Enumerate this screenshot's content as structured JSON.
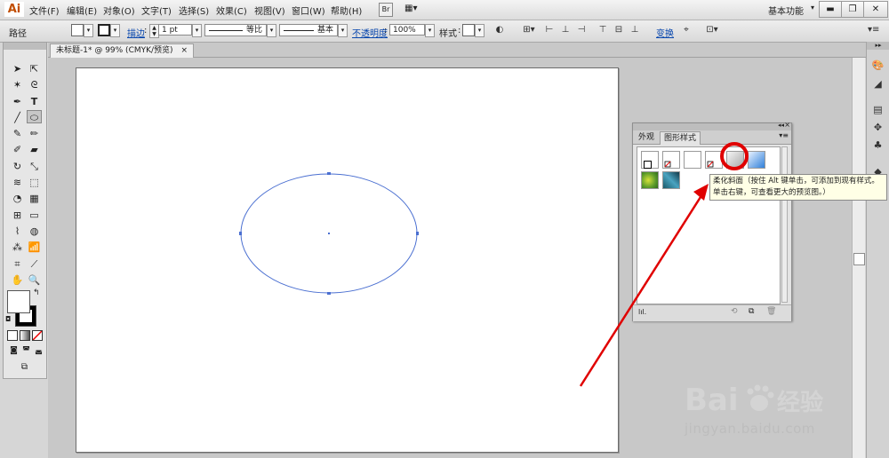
{
  "app": {
    "logo": "Ai",
    "menus": [
      "文件(F)",
      "编辑(E)",
      "对象(O)",
      "文字(T)",
      "选择(S)",
      "效果(C)",
      "视图(V)",
      "窗口(W)",
      "帮助(H)"
    ],
    "bridge_label": "Br",
    "workspace": "基本功能"
  },
  "control_bar": {
    "selection_type": "路径",
    "stroke_link": "描边",
    "stroke_weight": "1 pt",
    "profile_label": "等比",
    "brush_label": "基本",
    "opacity_link": "不透明度",
    "opacity_value": "100%",
    "style_label": "样式",
    "transform_link": "变换"
  },
  "document_tab": {
    "title": "未标题-1* @ 99% (CMYK/预览)",
    "close": "×"
  },
  "panel": {
    "tab_appearance": "外观",
    "tab_graphic_styles": "图形样式",
    "collapse_glyph": "◂◂",
    "close_glyph": "×",
    "menu_glyph": "▾≡",
    "library_button": "lıl.",
    "highlight_color": "#e00000"
  },
  "tooltip": {
    "line1": "柔化斜面（按住 Alt 键单击，可添加到现有样式。",
    "line2": "单击右键，可查看更大的预览图。）"
  },
  "watermark": {
    "brand": "Bai",
    "brand_suffix": "经验",
    "url": "jingyan.baidu.com"
  },
  "colors": {
    "annotation_red": "#e00000",
    "path_blue": "#4a6fd1",
    "ai_orange": "#c14d00"
  }
}
